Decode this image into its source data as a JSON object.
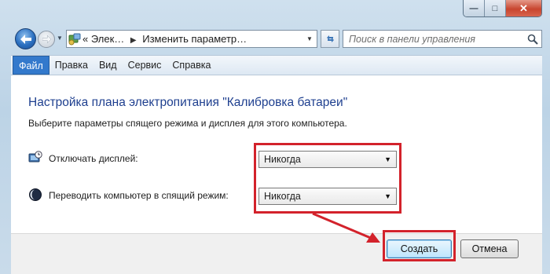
{
  "window": {
    "background_text": "…",
    "caption": {
      "minimize": "—",
      "maximize": "□",
      "close": "✕"
    }
  },
  "nav": {
    "address_parts": [
      "Элек…",
      "Изменить параметр…"
    ],
    "address_prefix": "«",
    "search_placeholder": "Поиск в панели управления"
  },
  "menu": {
    "items": [
      "Файл",
      "Правка",
      "Вид",
      "Сервис",
      "Справка"
    ],
    "active_index": 0
  },
  "content": {
    "title": "Настройка плана электропитания \"Калибровка батареи\"",
    "subtitle": "Выберите параметры спящего режима и дисплея для этого компьютера.",
    "display_off_label": "Отключать дисплей:",
    "display_off_value": "Никогда",
    "sleep_label": "Переводить компьютер в спящий режим:",
    "sleep_value": "Никогда"
  },
  "footer": {
    "create_label": "Создать",
    "cancel_label": "Отмена"
  },
  "colors": {
    "title_blue": "#1e3f8f",
    "highlight_red": "#d3222b",
    "menu_active": "#3379cc"
  }
}
